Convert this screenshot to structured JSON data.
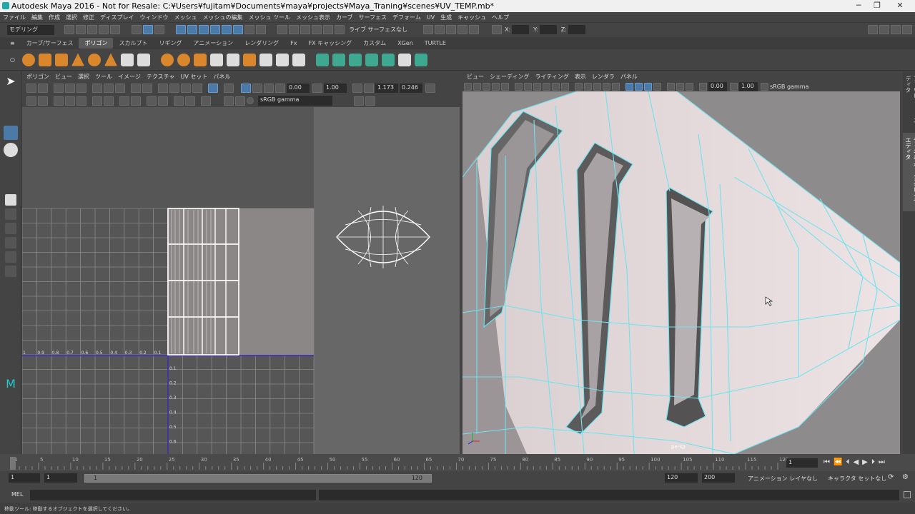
{
  "window": {
    "title": "Autodesk Maya 2016 - Not for Resale: C:¥Users¥fujitam¥Documents¥maya¥projects¥Maya_Traning¥scenes¥UV_TEMP.mb*"
  },
  "menubar": [
    "ファイル",
    "編集",
    "作成",
    "選択",
    "修正",
    "ディスプレイ",
    "ウィンドウ",
    "メッシュ",
    "メッシュの編集",
    "メッシュ ツール",
    "メッシュ表示",
    "カーブ",
    "サーフェス",
    "デフォーム",
    "UV",
    "生成",
    "キャッシュ",
    "ヘルプ"
  ],
  "status": {
    "mode": "モデリング",
    "snap_label": "ライブ サーフェスなし",
    "x_label": "X:",
    "y_label": "Y:",
    "z_label": "Z:"
  },
  "shelf_tabs": [
    "カーブ/サーフェス",
    "ポリゴン",
    "スカルプト",
    "リギング",
    "アニメーション",
    "レンダリング",
    "Fx",
    "FX キャッシング",
    "カスタム",
    "XGen",
    "TURTLE"
  ],
  "shelf_active": "ポリゴン",
  "uv_editor": {
    "menu": [
      "ポリゴン",
      "ビュー",
      "選択",
      "ツール",
      "イメージ",
      "テクスチャ",
      "UV セット",
      "パネル"
    ],
    "field_a": "0.00",
    "field_b": "1.00",
    "field_c": "1.173",
    "field_d": "0.246",
    "colorspace": "sRGB gamma",
    "u_ticks": [
      "1",
      "0.9",
      "0.8",
      "0.7",
      "0.6",
      "0.5",
      "0.4",
      "0.3",
      "0.2",
      "0.1"
    ],
    "v_ticks": [
      "0.1",
      "0.2",
      "0.3",
      "0.4",
      "0.5",
      "0.6"
    ]
  },
  "viewport": {
    "menu": [
      "ビュー",
      "シェーディング",
      "ライティング",
      "表示",
      "レンダラ",
      "パネル"
    ],
    "field_a": "0.00",
    "field_b": "1.00",
    "colorspace": "sRGB gamma",
    "camera": "persp"
  },
  "right_tabs": [
    "アトリビュート エディタ",
    "チャネル ボックス/レイヤ エディタ"
  ],
  "timeline": {
    "ticks": [
      "1",
      "5",
      "10",
      "15",
      "20",
      "25",
      "30",
      "35",
      "40",
      "45",
      "50",
      "55",
      "60",
      "65",
      "70",
      "75",
      "80",
      "85",
      "90",
      "95",
      "100",
      "105",
      "110",
      "115",
      "120"
    ],
    "current_frame": "1"
  },
  "range": {
    "start": "1",
    "start2": "1",
    "slider_start": "1",
    "slider_end": "120",
    "end": "120",
    "end2": "200",
    "anim_layer": "アニメーション レイヤなし",
    "char_set": "キャラクタ セットなし"
  },
  "command": {
    "label": "MEL"
  },
  "help": {
    "text": "移動ツール: 移動するオブジェクトを選択してください。"
  },
  "colors": {
    "wire": "#6fe3f0",
    "mesh": "#ebdedf",
    "uv_bg": "#676767",
    "accent": "#4b79a8"
  }
}
